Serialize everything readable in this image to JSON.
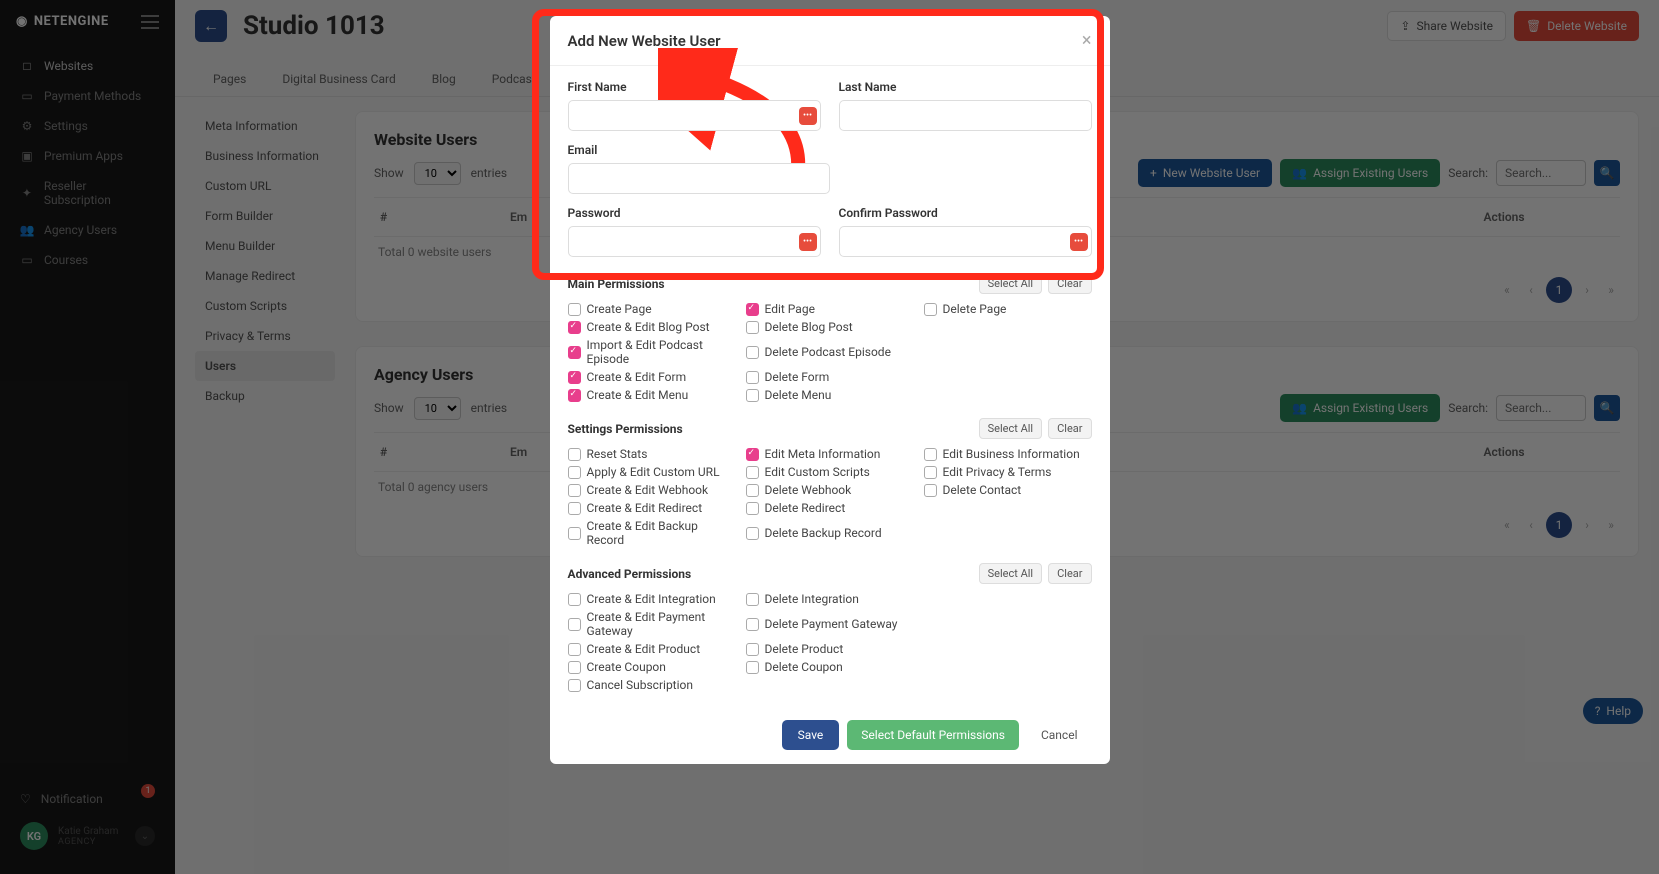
{
  "brand": "NETENGINE",
  "sidebar": {
    "items": [
      {
        "label": "Websites",
        "icon": "□"
      },
      {
        "label": "Payment Methods",
        "icon": "▭"
      },
      {
        "label": "Settings",
        "icon": "⚙"
      },
      {
        "label": "Premium Apps",
        "icon": "▣"
      },
      {
        "label": "Reseller Subscription",
        "icon": "✦"
      },
      {
        "label": "Agency Users",
        "icon": "👥"
      },
      {
        "label": "Courses",
        "icon": "▭"
      }
    ],
    "notification": {
      "label": "Notification",
      "badge": "1"
    },
    "user": {
      "initials": "KG",
      "name": "Katie Graham",
      "role": "AGENCY"
    }
  },
  "header": {
    "title": "Studio 1013",
    "share": "Share Website",
    "delete": "Delete Website"
  },
  "tabs": [
    "Pages",
    "Digital Business Card",
    "Blog",
    "Podcast"
  ],
  "sidemenu": [
    "Meta Information",
    "Business Information",
    "Custom URL",
    "Form Builder",
    "Menu Builder",
    "Manage Redirect",
    "Custom Scripts",
    "Privacy & Terms",
    "Users",
    "Backup"
  ],
  "table": {
    "show": "Show",
    "entries": "entries",
    "entriesValue": "10",
    "search": "Search:",
    "searchPlaceholder": "Search...",
    "hash": "#",
    "email": "Em",
    "actions": "Actions",
    "page": "1"
  },
  "cards": {
    "website": {
      "title": "Website Users",
      "newBtn": "New Website User",
      "assignBtn": "Assign Existing Users",
      "total": "Total 0 website users"
    },
    "agency": {
      "title": "Agency Users",
      "assignBtn": "Assign Existing Users",
      "total": "Total 0 agency users"
    }
  },
  "modal": {
    "title": "Add New Website User",
    "labels": {
      "firstName": "First Name",
      "lastName": "Last Name",
      "email": "Email",
      "password": "Password",
      "confirmPassword": "Confirm Password"
    },
    "sections": {
      "main": {
        "title": "Main Permissions",
        "selectAll": "Select All",
        "clear": "Clear",
        "items": [
          {
            "label": "Create Page",
            "checked": false
          },
          {
            "label": "Edit Page",
            "checked": true
          },
          {
            "label": "Delete Page",
            "checked": false
          },
          {
            "label": "Create & Edit Blog Post",
            "checked": true
          },
          {
            "label": "Delete Blog Post",
            "checked": false
          },
          {
            "label": "",
            "checked": false,
            "empty": true
          },
          {
            "label": "Import & Edit Podcast Episode",
            "checked": true
          },
          {
            "label": "Delete Podcast Episode",
            "checked": false
          },
          {
            "label": "",
            "checked": false,
            "empty": true
          },
          {
            "label": "Create & Edit Form",
            "checked": true
          },
          {
            "label": "Delete Form",
            "checked": false
          },
          {
            "label": "",
            "checked": false,
            "empty": true
          },
          {
            "label": "Create & Edit Menu",
            "checked": true
          },
          {
            "label": "Delete Menu",
            "checked": false
          }
        ]
      },
      "settings": {
        "title": "Settings Permissions",
        "selectAll": "Select All",
        "clear": "Clear",
        "items": [
          {
            "label": "Reset Stats",
            "checked": false
          },
          {
            "label": "Edit Meta Information",
            "checked": true
          },
          {
            "label": "Edit Business Information",
            "checked": false
          },
          {
            "label": "Apply & Edit Custom URL",
            "checked": false
          },
          {
            "label": "Edit Custom Scripts",
            "checked": false
          },
          {
            "label": "Edit Privacy & Terms",
            "checked": false
          },
          {
            "label": "Create & Edit Webhook",
            "checked": false
          },
          {
            "label": "Delete Webhook",
            "checked": false
          },
          {
            "label": "Delete Contact",
            "checked": false
          },
          {
            "label": "Create & Edit Redirect",
            "checked": false
          },
          {
            "label": "Delete Redirect",
            "checked": false
          },
          {
            "label": "",
            "checked": false,
            "empty": true
          },
          {
            "label": "Create & Edit Backup Record",
            "checked": false
          },
          {
            "label": "Delete Backup Record",
            "checked": false
          }
        ]
      },
      "advanced": {
        "title": "Advanced Permissions",
        "selectAll": "Select All",
        "clear": "Clear",
        "items": [
          {
            "label": "Create & Edit Integration",
            "checked": false
          },
          {
            "label": "Delete Integration",
            "checked": false
          },
          {
            "label": "",
            "checked": false,
            "empty": true
          },
          {
            "label": "Create & Edit Payment Gateway",
            "checked": false
          },
          {
            "label": "Delete Payment Gateway",
            "checked": false
          },
          {
            "label": "",
            "checked": false,
            "empty": true
          },
          {
            "label": "Create & Edit Product",
            "checked": false
          },
          {
            "label": "Delete Product",
            "checked": false
          },
          {
            "label": "",
            "checked": false,
            "empty": true
          },
          {
            "label": "Create Coupon",
            "checked": false
          },
          {
            "label": "Delete Coupon",
            "checked": false
          },
          {
            "label": "",
            "checked": false,
            "empty": true
          },
          {
            "label": "Cancel Subscription",
            "checked": false
          }
        ]
      }
    },
    "footer": {
      "save": "Save",
      "default": "Select Default Permissions",
      "cancel": "Cancel"
    }
  },
  "help": "Help"
}
